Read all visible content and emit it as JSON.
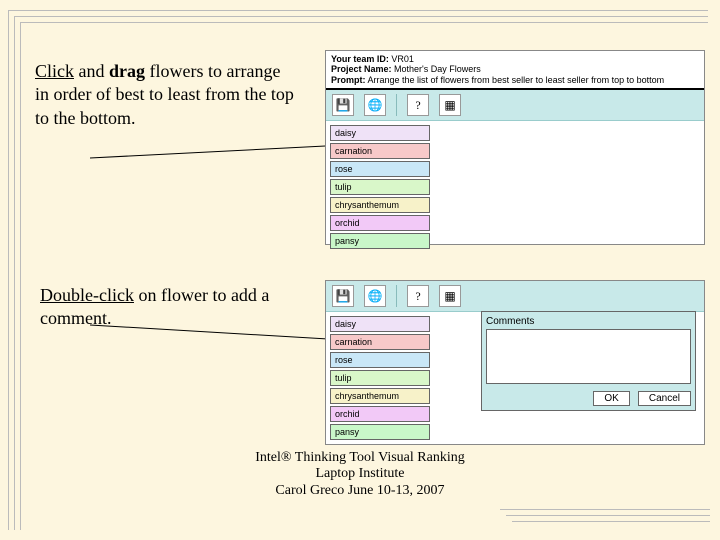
{
  "instructions": {
    "drag_prefix": "Click",
    "drag_mid": " and ",
    "drag_bold": "drag",
    "drag_rest": " flowers to arrange in order of best to least from the top to the bottom.",
    "comment_prefix": "Double-click",
    "comment_rest": " on flower to add a comment."
  },
  "header": {
    "team_label": "Your team ID:",
    "team_value": "VR01",
    "project_label": "Project Name:",
    "project_value": "Mother's Day Flowers",
    "prompt_label": "Prompt:",
    "prompt_value": "Arrange the list of flowers from best seller to least seller from top to bottom"
  },
  "toolbar": {
    "icons": [
      "save-icon",
      "globe-icon",
      "question-icon",
      "compare-icon"
    ]
  },
  "flowers": [
    {
      "name": "daisy",
      "cls": "c-daisy"
    },
    {
      "name": "carnation",
      "cls": "c-carnation"
    },
    {
      "name": "rose",
      "cls": "c-rose"
    },
    {
      "name": "tulip",
      "cls": "c-tulip"
    },
    {
      "name": "chrysanthemum",
      "cls": "c-chrys"
    },
    {
      "name": "orchid",
      "cls": "c-orchid"
    },
    {
      "name": "pansy",
      "cls": "c-pansy"
    }
  ],
  "comment_dialog": {
    "label": "Comments",
    "ok": "OK",
    "cancel": "Cancel"
  },
  "footer": {
    "line1": "Intel® Thinking Tool Visual Ranking",
    "line2": "Laptop Institute",
    "line3": "Carol Greco June 10-13, 2007"
  }
}
